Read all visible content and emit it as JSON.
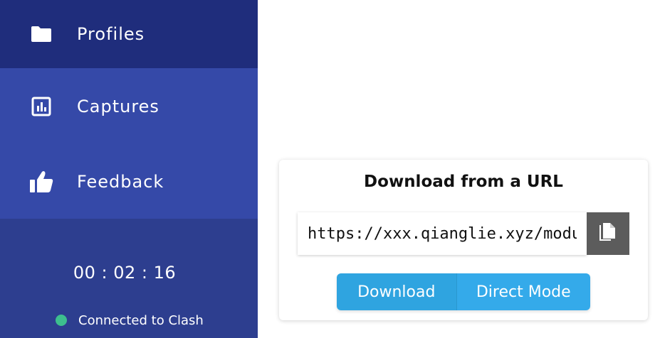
{
  "sidebar": {
    "items": [
      {
        "label": "Profiles",
        "icon": "folder-icon"
      },
      {
        "label": "Captures",
        "icon": "chart-icon"
      },
      {
        "label": "Feedback",
        "icon": "thumbs-up-icon"
      }
    ],
    "timer": "00 : 02 : 16",
    "status": {
      "text": "Connected to Clash",
      "color": "#3dbf8e"
    }
  },
  "download_card": {
    "title": "Download from a URL",
    "url_value": "https://xxx.qianglie.xyz/module",
    "copy_icon": "copy-icon",
    "buttons": {
      "download": "Download",
      "direct_mode": "Direct Mode"
    }
  },
  "colors": {
    "sidebar_bg": "#2d3e8f",
    "sidebar_active": "#1f2d7c",
    "sidebar_item": "#3549a8",
    "accent": "#34aaea",
    "copy_button": "#5c5c5c"
  }
}
